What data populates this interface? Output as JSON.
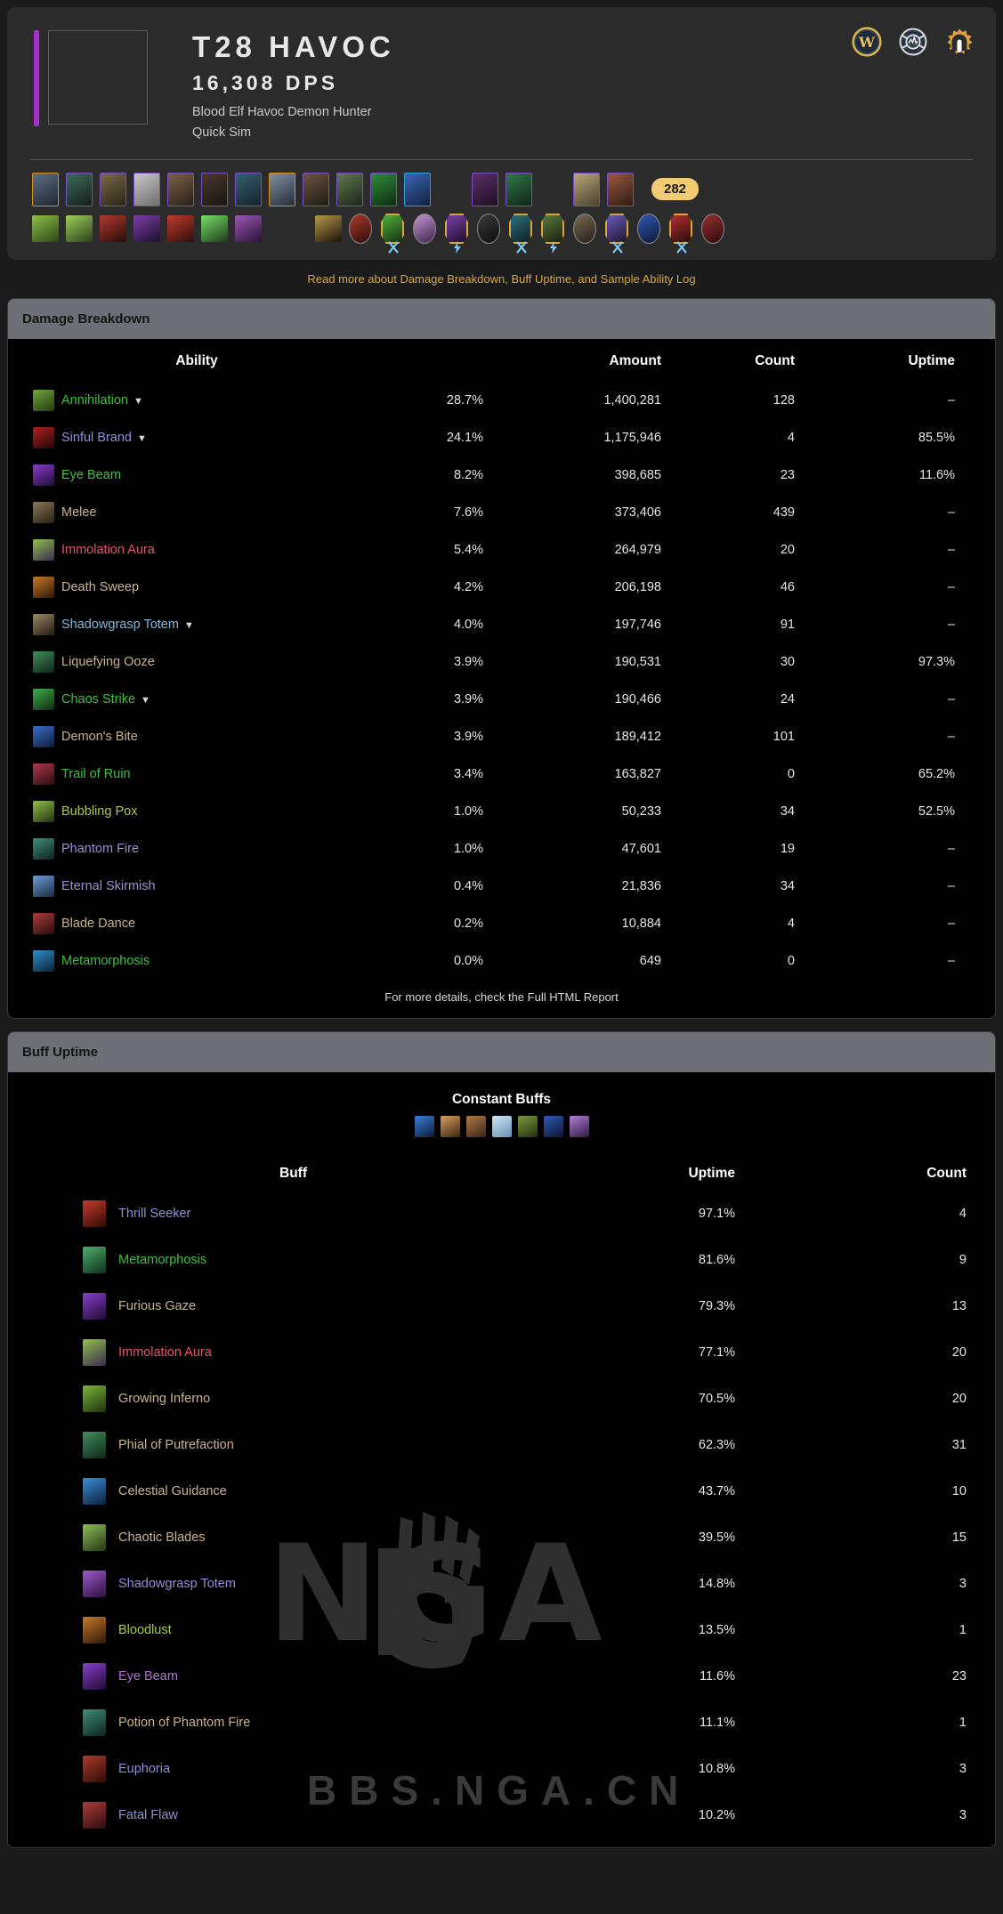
{
  "header": {
    "title": "T28 HAVOC",
    "dps": "16,308 DPS",
    "subtitle": "Blood Elf Havoc Demon Hunter",
    "sim_type": "Quick Sim",
    "ilvl_badge": "282",
    "icons": [
      {
        "name": "wow-armory-icon",
        "label": "W"
      },
      {
        "name": "warcraft-logs-icon",
        "label": ""
      },
      {
        "name": "raidbots-icon",
        "label": ""
      }
    ],
    "spec_color": "#a330c9"
  },
  "read_more": {
    "text": "Read more about Damage Breakdown, Buff Uptime, and Sample Ability Log",
    "color": "#d9a53c"
  },
  "gear": {
    "row1": [
      {
        "name": "gear-head",
        "quality": "legendary"
      },
      {
        "name": "gear-neck",
        "quality": "epic"
      },
      {
        "name": "gear-shoulder",
        "quality": "epic"
      },
      {
        "name": "gear-back",
        "quality": "epic"
      },
      {
        "name": "gear-chest",
        "quality": "epic"
      },
      {
        "name": "gear-waist",
        "quality": "epic"
      },
      {
        "name": "gear-wrist",
        "quality": "epic"
      },
      {
        "name": "gear-hands",
        "quality": "legendary"
      },
      {
        "name": "gear-legs",
        "quality": "epic"
      },
      {
        "name": "gear-feet",
        "quality": "epic"
      },
      {
        "name": "gear-ring1",
        "quality": "epic"
      },
      {
        "name": "gear-ring2",
        "quality": "blue"
      },
      {
        "name": "gear-spacer-1",
        "quality": "spacer"
      },
      {
        "name": "gear-trinket1",
        "quality": "epic"
      },
      {
        "name": "gear-trinket2",
        "quality": "epic"
      },
      {
        "name": "gear-spacer-2",
        "quality": "spacer"
      },
      {
        "name": "gear-mainhand",
        "quality": "epic"
      },
      {
        "name": "gear-offhand",
        "quality": "epic"
      }
    ],
    "row2_talents": [
      "talent-1",
      "talent-2",
      "talent-3",
      "talent-4",
      "talent-5",
      "talent-6",
      "talent-7"
    ],
    "row2_soulbinds": [
      {
        "name": "covenant-icon",
        "type": "plain"
      },
      {
        "name": "soulbind-1",
        "type": "oval"
      },
      {
        "name": "conduit-1",
        "type": "gold",
        "rank": "x"
      },
      {
        "name": "soulbind-2",
        "type": "oval"
      },
      {
        "name": "conduit-2",
        "type": "gold",
        "rank": "bolt"
      },
      {
        "name": "soulbind-3",
        "type": "oval"
      },
      {
        "name": "conduit-3",
        "type": "gold",
        "rank": "x"
      },
      {
        "name": "conduit-4",
        "type": "gold",
        "rank": "bolt"
      },
      {
        "name": "soulbind-4",
        "type": "oval"
      },
      {
        "name": "conduit-5",
        "type": "gold",
        "rank": "x"
      },
      {
        "name": "soulbind-5",
        "type": "oval"
      },
      {
        "name": "conduit-6",
        "type": "gold",
        "rank": "x"
      },
      {
        "name": "soulbind-6",
        "type": "oval"
      }
    ]
  },
  "damage_breakdown": {
    "panel_title": "Damage Breakdown",
    "columns": [
      "Ability",
      "",
      "Amount",
      "Count",
      "Uptime"
    ],
    "footnote": "For more details, check the Full HTML Report",
    "rows": [
      {
        "ability": "Annihilation",
        "color": "#3fbf3f",
        "caret": true,
        "pct": "28.7%",
        "amount": "1,400,281",
        "count": "128",
        "uptime": "–"
      },
      {
        "ability": "Sinful Brand",
        "color": "#8f8fd8",
        "caret": true,
        "pct": "24.1%",
        "amount": "1,175,946",
        "count": "4",
        "uptime": "85.5%"
      },
      {
        "ability": "Eye Beam",
        "color": "#3fbf3f",
        "caret": false,
        "pct": "8.2%",
        "amount": "398,685",
        "count": "23",
        "uptime": "11.6%"
      },
      {
        "ability": "Melee",
        "color": "#c8b48c",
        "caret": false,
        "pct": "7.6%",
        "amount": "373,406",
        "count": "439",
        "uptime": "–"
      },
      {
        "ability": "Immolation Aura",
        "color": "#e0556b",
        "caret": false,
        "pct": "5.4%",
        "amount": "264,979",
        "count": "20",
        "uptime": "–"
      },
      {
        "ability": "Death Sweep",
        "color": "#c8b48c",
        "caret": false,
        "pct": "4.2%",
        "amount": "206,198",
        "count": "46",
        "uptime": "–"
      },
      {
        "ability": "Shadowgrasp Totem",
        "color": "#7fb8dc",
        "caret": true,
        "pct": "4.0%",
        "amount": "197,746",
        "count": "91",
        "uptime": "–"
      },
      {
        "ability": "Liquefying Ooze",
        "color": "#c8b48c",
        "caret": false,
        "pct": "3.9%",
        "amount": "190,531",
        "count": "30",
        "uptime": "97.3%"
      },
      {
        "ability": "Chaos Strike",
        "color": "#3fbf3f",
        "caret": true,
        "pct": "3.9%",
        "amount": "190,466",
        "count": "24",
        "uptime": "–"
      },
      {
        "ability": "Demon's Bite",
        "color": "#c8b48c",
        "caret": false,
        "pct": "3.9%",
        "amount": "189,412",
        "count": "101",
        "uptime": "–"
      },
      {
        "ability": "Trail of Ruin",
        "color": "#3fbf3f",
        "caret": false,
        "pct": "3.4%",
        "amount": "163,827",
        "count": "0",
        "uptime": "65.2%"
      },
      {
        "ability": "Bubbling Pox",
        "color": "#aac850",
        "caret": false,
        "pct": "1.0%",
        "amount": "50,233",
        "count": "34",
        "uptime": "52.5%"
      },
      {
        "ability": "Phantom Fire",
        "color": "#9a8fd0",
        "caret": false,
        "pct": "1.0%",
        "amount": "47,601",
        "count": "19",
        "uptime": "–"
      },
      {
        "ability": "Eternal Skirmish",
        "color": "#9a8fd0",
        "caret": false,
        "pct": "0.4%",
        "amount": "21,836",
        "count": "34",
        "uptime": "–"
      },
      {
        "ability": "Blade Dance",
        "color": "#c8b48c",
        "caret": false,
        "pct": "0.2%",
        "amount": "10,884",
        "count": "4",
        "uptime": "–"
      },
      {
        "ability": "Metamorphosis",
        "color": "#3fbf3f",
        "caret": false,
        "pct": "0.0%",
        "amount": "649",
        "count": "0",
        "uptime": "–"
      }
    ]
  },
  "buff_uptime": {
    "panel_title": "Buff Uptime",
    "constant_buffs_title": "Constant Buffs",
    "constant_buffs_icons": [
      "buff-icon-1",
      "buff-icon-2",
      "buff-icon-3",
      "buff-icon-4",
      "buff-icon-5",
      "buff-icon-6",
      "buff-icon-7"
    ],
    "columns": [
      "Buff",
      "Uptime",
      "Count"
    ],
    "rows": [
      {
        "buff": "Thrill Seeker",
        "color": "#8f8fd8",
        "uptime": "97.1%",
        "count": "4"
      },
      {
        "buff": "Metamorphosis",
        "color": "#3fbf3f",
        "uptime": "81.6%",
        "count": "9"
      },
      {
        "buff": "Furious Gaze",
        "color": "#c8b48c",
        "uptime": "79.3%",
        "count": "13"
      },
      {
        "buff": "Immolation Aura",
        "color": "#e0556b",
        "uptime": "77.1%",
        "count": "20"
      },
      {
        "buff": "Growing Inferno",
        "color": "#c8b48c",
        "uptime": "70.5%",
        "count": "20"
      },
      {
        "buff": "Phial of Putrefaction",
        "color": "#c8b48c",
        "uptime": "62.3%",
        "count": "31"
      },
      {
        "buff": "Celestial Guidance",
        "color": "#c8b48c",
        "uptime": "43.7%",
        "count": "10"
      },
      {
        "buff": "Chaotic Blades",
        "color": "#c8b48c",
        "uptime": "39.5%",
        "count": "15"
      },
      {
        "buff": "Shadowgrasp Totem",
        "color": "#8f8fd8",
        "uptime": "14.8%",
        "count": "3"
      },
      {
        "buff": "Bloodlust",
        "color": "#aac850",
        "uptime": "13.5%",
        "count": "1"
      },
      {
        "buff": "Eye Beam",
        "color": "#b070d0",
        "uptime": "11.6%",
        "count": "23"
      },
      {
        "buff": "Potion of Phantom Fire",
        "color": "#c8b48c",
        "uptime": "11.1%",
        "count": "1"
      },
      {
        "buff": "Euphoria",
        "color": "#8f8fd8",
        "uptime": "10.8%",
        "count": "3"
      },
      {
        "buff": "Fatal Flaw",
        "color": "#8f8fd8",
        "uptime": "10.2%",
        "count": "3"
      }
    ]
  },
  "watermark": {
    "logo_text": "NGA",
    "footer_text": "BBS.NGA.CN"
  }
}
